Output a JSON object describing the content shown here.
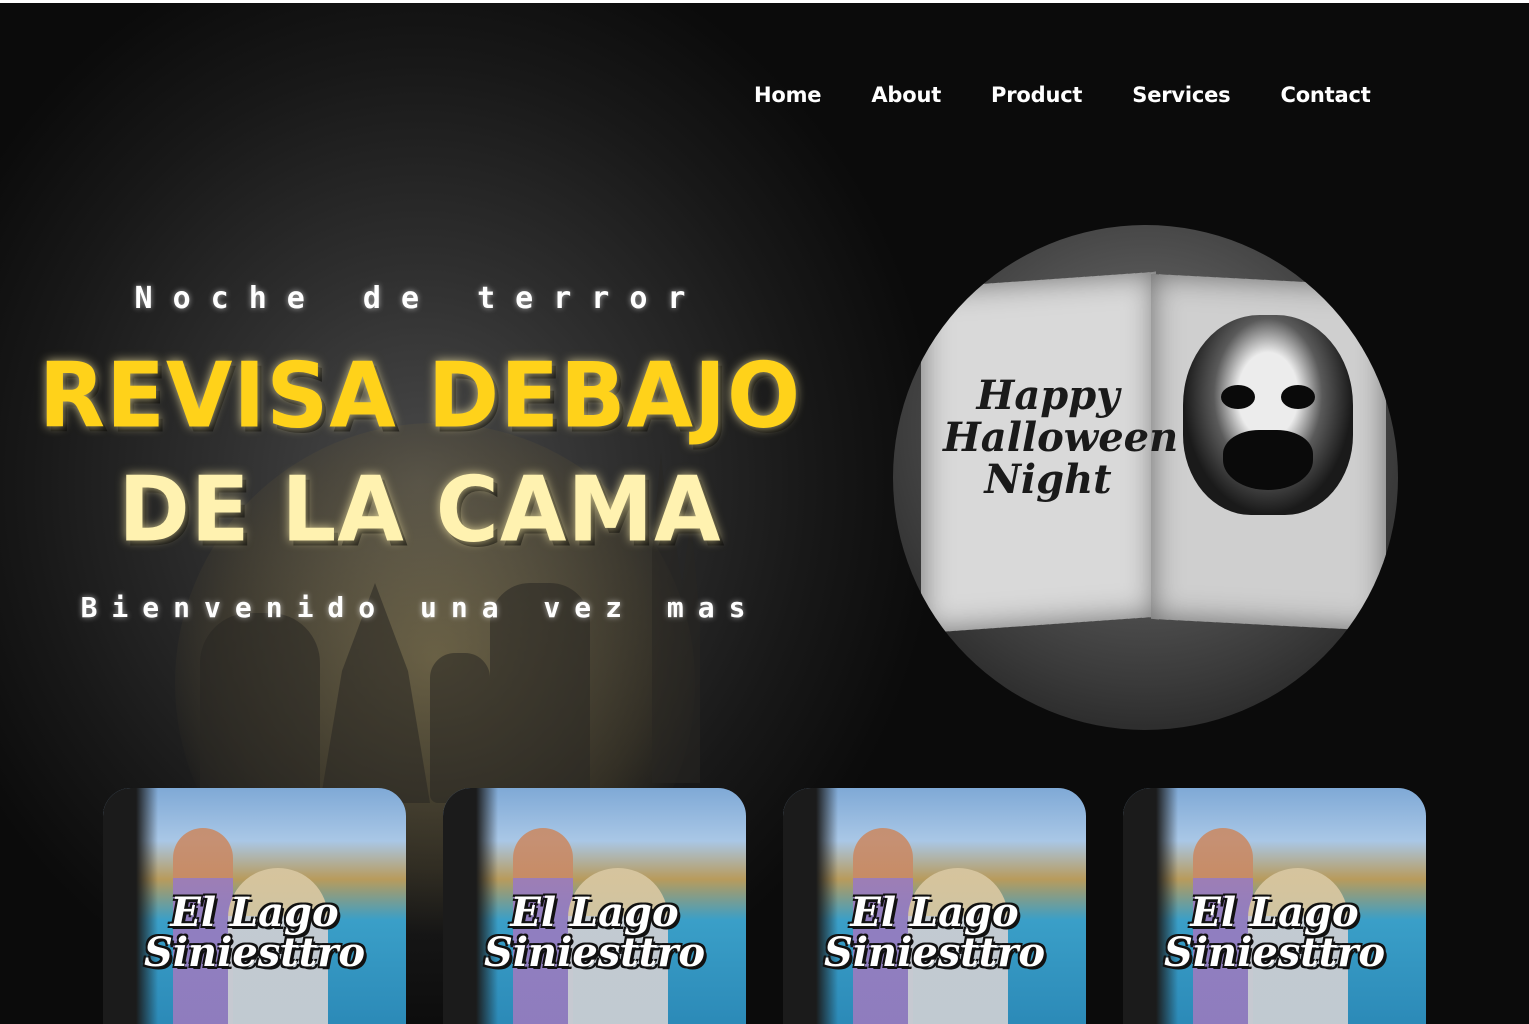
{
  "nav": {
    "items": [
      "Home",
      "About",
      "Product",
      "Services",
      "Contact"
    ]
  },
  "hero": {
    "kicker": "Noche de terror",
    "headline_line1": "REVISA DEBAJO",
    "headline_line2": "DE LA CAMA",
    "subtitle": "Bienvenido una vez mas",
    "book_text": "Happy Halloween Night"
  },
  "cards": [
    {
      "title": "El Lago Siniesttro"
    },
    {
      "title": "El Lago Siniesttro"
    },
    {
      "title": "El Lago Siniesttro"
    },
    {
      "title": "El Lago Siniesttro"
    }
  ],
  "colors": {
    "headline_primary": "#ffd21a",
    "headline_secondary": "#fff2b0",
    "nav_text": "#ffffff",
    "background": "#111111"
  }
}
